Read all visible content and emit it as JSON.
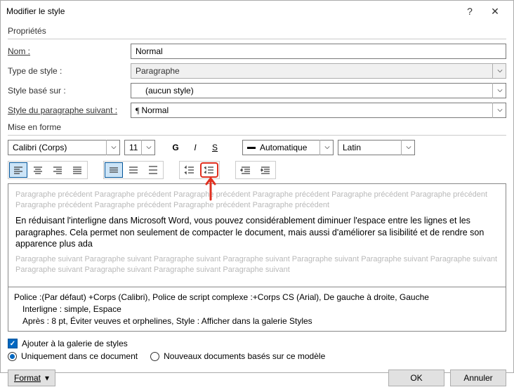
{
  "dialog": {
    "title": "Modifier le style"
  },
  "sections": {
    "properties": "Propriétés",
    "formatting": "Mise en forme"
  },
  "props": {
    "name_label": "Nom :",
    "name_value": "Normal",
    "type_label": "Type de style :",
    "type_value": "Paragraphe",
    "based_label": "Style basé sur :",
    "based_value": "(aucun style)",
    "follow_label": "Style du paragraphe suivant :",
    "follow_value": "Normal"
  },
  "format": {
    "font": "Calibri (Corps)",
    "size": "11",
    "bold": "G",
    "italic": "I",
    "underline": "S",
    "color_label": "Automatique",
    "lang": "Latin"
  },
  "preview": {
    "prev": "Paragraphe précédent Paragraphe précédent Paragraphe précédent Paragraphe précédent Paragraphe précédent Paragraphe précédent Paragraphe précédent Paragraphe précédent Paragraphe précédent Paragraphe précédent",
    "body": "En réduisant l'interligne dans Microsoft Word, vous pouvez considérablement diminuer l'espace entre les lignes et les paragraphes. Cela permet non seulement de compacter le document, mais aussi d'améliorer sa lisibilité et de rendre son apparence plus ada",
    "next": "Paragraphe suivant Paragraphe suivant Paragraphe suivant Paragraphe suivant Paragraphe suivant Paragraphe suivant Paragraphe suivant Paragraphe suivant Paragraphe suivant Paragraphe suivant Paragraphe suivant"
  },
  "desc": {
    "l1": "Police :(Par défaut) +Corps (Calibri), Police de script complexe :+Corps CS (Arial), De gauche à droite, Gauche",
    "l2": "Interligne : simple, Espace",
    "l3": "Après : 8 pt, Éviter veuves et orphelines, Style : Afficher dans la galerie Styles"
  },
  "opts": {
    "gallery": "Ajouter à la galerie de styles",
    "only_doc": "Uniquement dans ce document",
    "new_docs": "Nouveaux documents basés sur ce modèle"
  },
  "buttons": {
    "format": "Format",
    "ok": "OK",
    "cancel": "Annuler"
  }
}
